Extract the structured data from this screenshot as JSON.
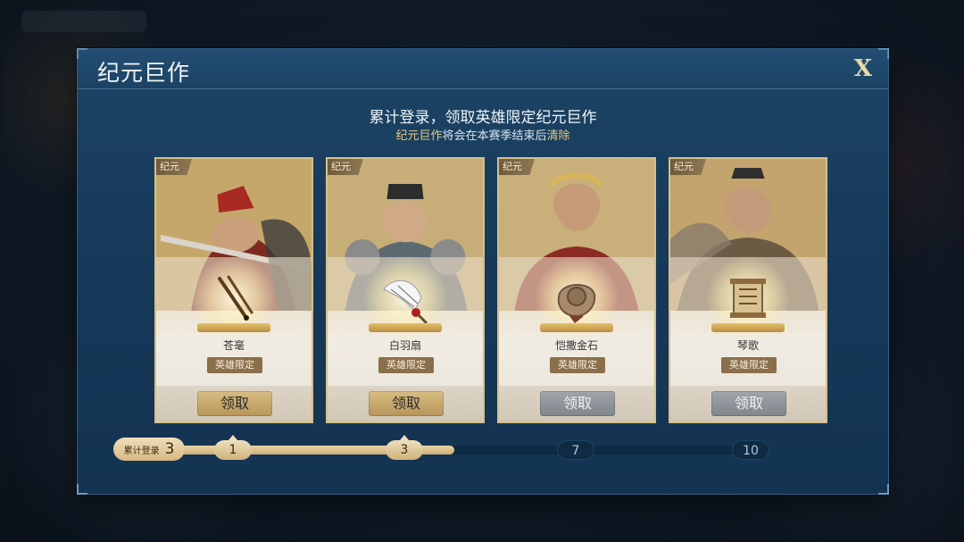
{
  "dialog": {
    "title": "纪元巨作",
    "close_label": "X",
    "subtitle_main": "累计登录，领取英雄限定纪元巨作",
    "subtitle_note": {
      "part1": "纪元巨作",
      "part2": "将会在本赛季结束后",
      "part3": "清除"
    }
  },
  "cards": [
    {
      "tag": "纪元",
      "item_name": "苍毫",
      "limit_label": "英雄限定",
      "button_label": "领取",
      "button_state": "active",
      "icon": "brush-icon"
    },
    {
      "tag": "纪元",
      "item_name": "白羽扇",
      "limit_label": "英雄限定",
      "button_label": "领取",
      "button_state": "active",
      "icon": "feather-fan-icon"
    },
    {
      "tag": "纪元",
      "item_name": "恺撒金石",
      "limit_label": "英雄限定",
      "button_label": "领取",
      "button_state": "disabled",
      "icon": "stone-icon"
    },
    {
      "tag": "纪元",
      "item_name": "琴歌",
      "limit_label": "英雄限定",
      "button_label": "领取",
      "button_state": "disabled",
      "icon": "scroll-icon"
    }
  ],
  "progress": {
    "cumulative_label": "累计登录",
    "cumulative_value": "3",
    "nodes": [
      {
        "label": "1",
        "state": "reached"
      },
      {
        "label": "3",
        "state": "reached"
      },
      {
        "label": "7",
        "state": "locked"
      },
      {
        "label": "10",
        "state": "locked"
      }
    ]
  },
  "colors": {
    "panel": "#17395a",
    "gold_accent": "#e7c982",
    "card_border": "#d7c08a"
  }
}
